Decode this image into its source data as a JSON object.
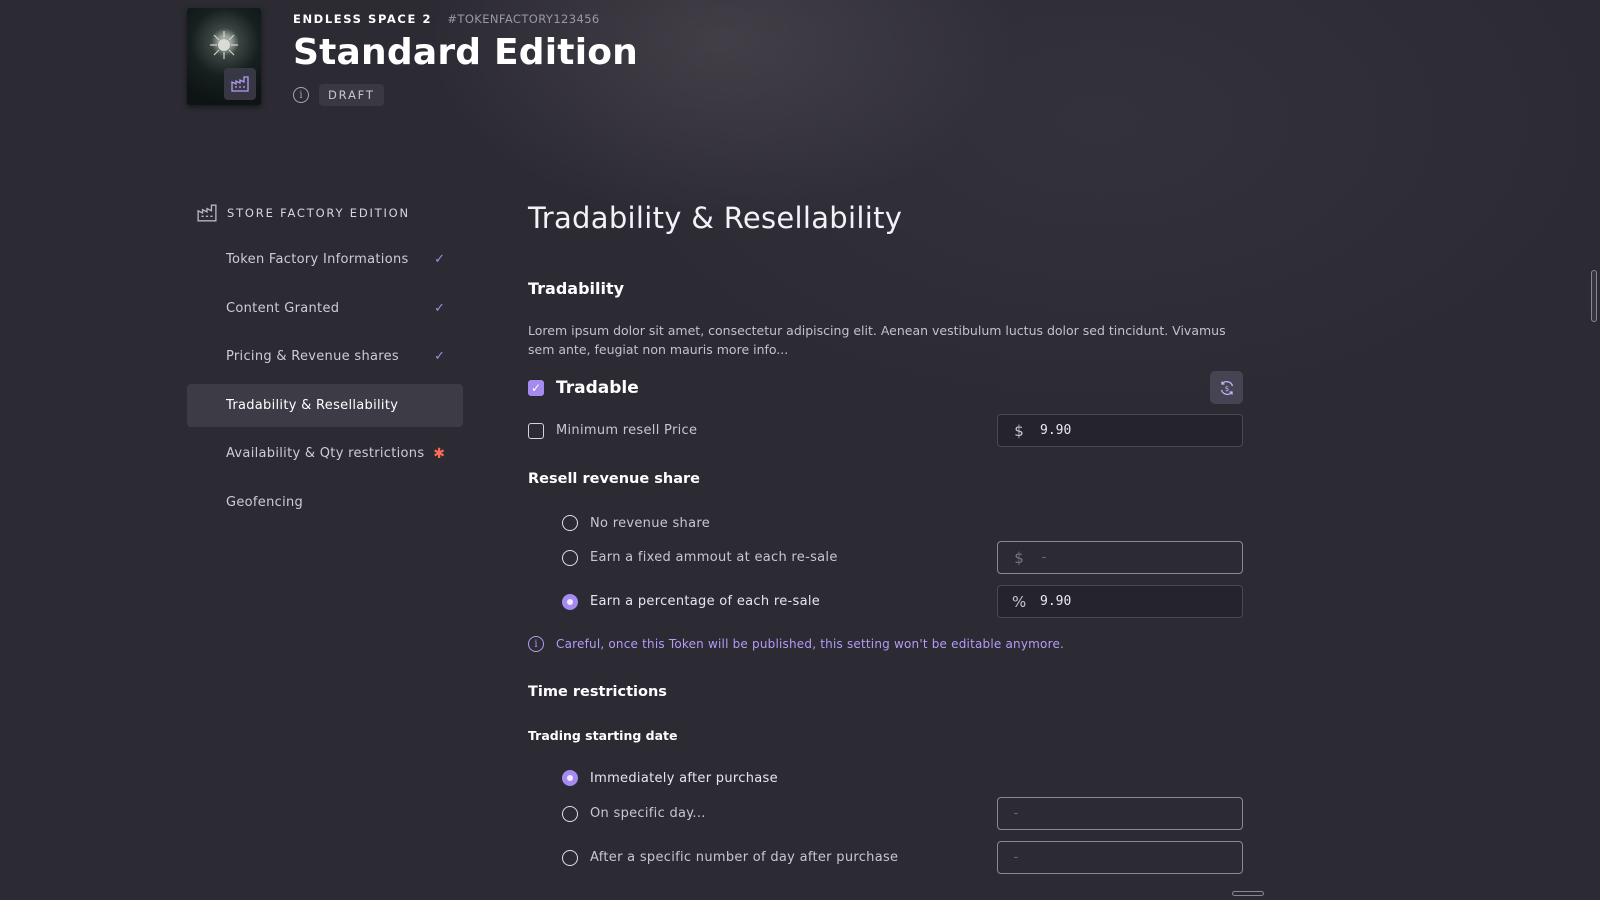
{
  "header": {
    "game_name": "ENDLESS SPACE 2",
    "token_id": "#TOKENFACTORY123456",
    "title": "Standard Edition",
    "status": "DRAFT",
    "cover_icon": "factory-icon"
  },
  "sidebar": {
    "heading": "STORE FACTORY EDITION",
    "heading_icon": "factory-icon",
    "items": [
      {
        "label": "Token Factory Informations",
        "state": "done"
      },
      {
        "label": "Content Granted",
        "state": "done"
      },
      {
        "label": "Pricing & Revenue shares",
        "state": "done"
      },
      {
        "label": "Tradability & Resellability",
        "state": "active"
      },
      {
        "label": "Availability & Qty restrictions",
        "state": "required"
      },
      {
        "label": "Geofencing",
        "state": "none"
      }
    ]
  },
  "main": {
    "page_title": "Tradability & Resellability",
    "tradability": {
      "title": "Tradability",
      "description": "Lorem ipsum dolor sit amet, consectetur adipiscing elit. Aenean vestibulum luctus dolor sed tincidunt. Vivamus sem ante, feugiat non mauris more info...",
      "tradable_label": "Tradable",
      "tradable_checked": true,
      "min_price_label": "Minimum resell Price",
      "min_price_checked": false,
      "min_price_unit": "$",
      "min_price_value": "9.90"
    },
    "revenue_share": {
      "title": "Resell revenue share",
      "options": [
        {
          "label": "No revenue share",
          "selected": false
        },
        {
          "label": "Earn a fixed ammout at each re-sale",
          "selected": false,
          "unit": "$",
          "value": "-"
        },
        {
          "label": "Earn a percentage of each re-sale",
          "selected": true,
          "unit": "%",
          "value": "9.90"
        }
      ],
      "warning": "Careful, once this Token will be published, this setting won't be editable anymore."
    },
    "time_restrictions": {
      "title": "Time restrictions",
      "subtitle": "Trading starting date",
      "options": [
        {
          "label": "Immediately after purchase",
          "selected": true
        },
        {
          "label": "On specific day...",
          "selected": false,
          "value": "-"
        },
        {
          "label": "After a specific number of day after purchase",
          "selected": false,
          "value": "-"
        }
      ]
    }
  },
  "colors": {
    "accent": "#a58bf0",
    "background": "#2c2a33",
    "required": "#ff6a58"
  }
}
